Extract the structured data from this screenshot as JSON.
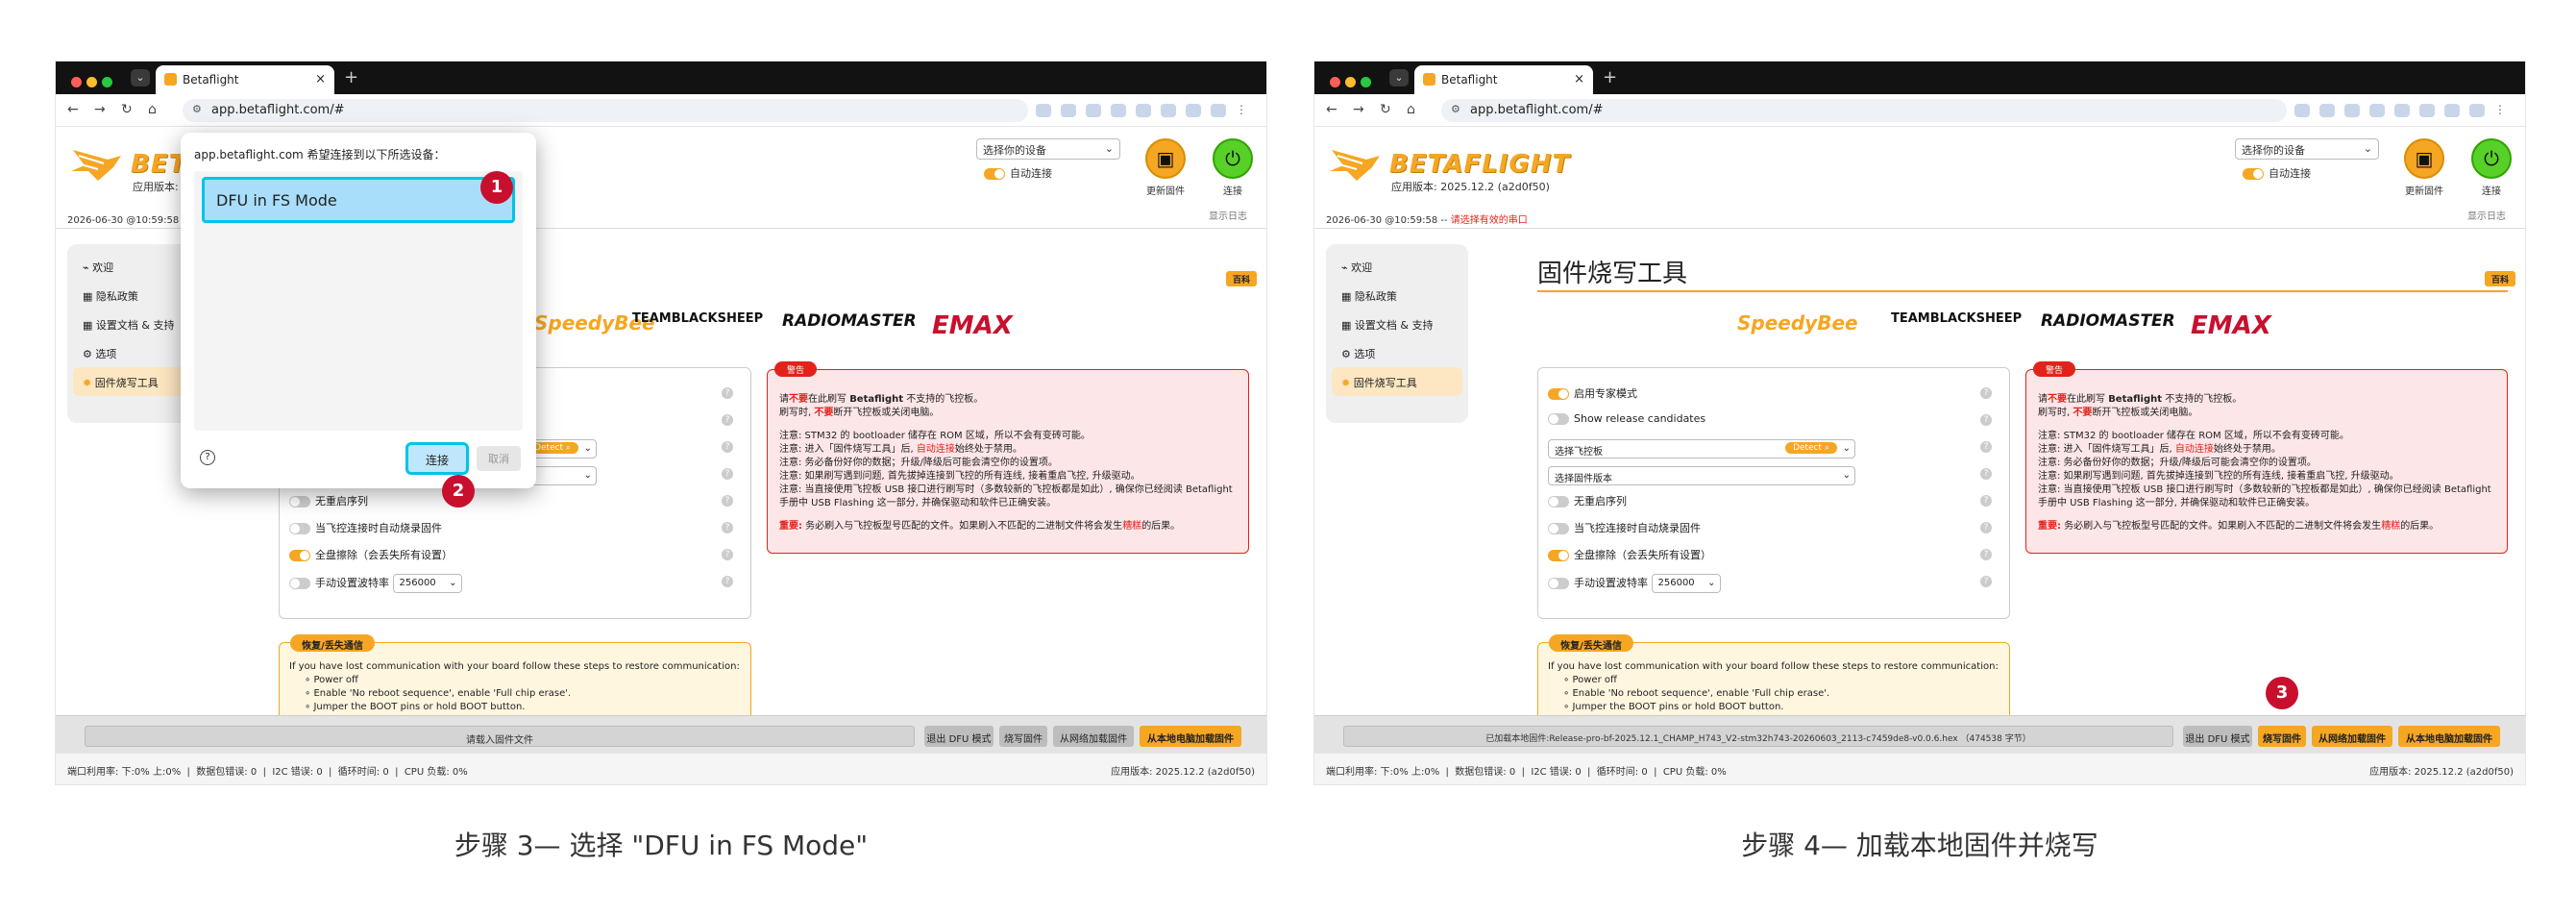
{
  "browser": {
    "tab_title": "Betaflight",
    "url": "app.betaflight.com/#"
  },
  "app": {
    "logo_text": "BETAFLIGHT",
    "version_line": "应用版本: 2025.12.2 (a2d0f50)",
    "port_select": "选择你的设备",
    "auto_connect": "自动连接",
    "update_fw_label": "更新固件",
    "connect_label": "连接",
    "date_line": "2026-06-30 @10:59:58 -- ",
    "date_warning": "请选择有效的串口",
    "show_log": "显示日志",
    "sidebar": [
      {
        "icon": "welcome-icon",
        "label": "欢迎"
      },
      {
        "icon": "privacy-icon",
        "label": "隐私政策"
      },
      {
        "icon": "docs-icon",
        "label": "设置文档 & 支持"
      },
      {
        "icon": "gear-icon",
        "label": "选项"
      },
      {
        "icon": "flash-icon",
        "label": "固件烧写工具"
      }
    ],
    "content_title": "固件烧写工具",
    "wiki_badge": "百科",
    "brands": [
      "SpeedyBee",
      "TEAMBLACKSHEEP",
      "RADIOMASTER",
      "EMAX"
    ],
    "options": {
      "expert_mode": "启用专家模式",
      "show_release": "Show release candidates",
      "board_select": "选择飞控板",
      "detect": "Detect",
      "firmware_select": "选择固件版本",
      "no_reboot": "无重启序列",
      "auto_flash": "当飞控连接时自动烧录固件",
      "full_erase": "全盘擦除（会丢失所有设置）",
      "manual_baud": "手动设置波特率",
      "baud_value": "256000"
    },
    "warning": {
      "badge": "警告",
      "l1a": "请",
      "l1b": "不要",
      "l1c": "在此刷写 ",
      "l1d": "Betaflight",
      "l1e": " 不支持的飞控板。",
      "l2a": "刷写时, ",
      "l2b": "不要",
      "l2c": "断开飞控板或关闭电脑。",
      "n1": "注意: STM32 的 bootloader 储存在 ROM 区域，所以不会有变砖可能。",
      "n2a": "注意: 进入「固件烧写工具」后, ",
      "n2b": "自动连接",
      "n2c": "始终处于禁用。",
      "n3": "注意: 务必备份好你的数据；升级/降级后可能会清空你的设置项。",
      "n4": "注意: 如果刷写遇到问题, 首先拔掉连接到飞控的所有连线, 接着重启飞控, 升级驱动。",
      "n5": "注意: 当直接使用飞控板 USB 接口进行刷写时（多数较新的飞控板都是如此）, 确保你已经阅读 Betaflight 手册中 USB Flashing 这一部分, 并确保驱动和软件已正确安装。",
      "imp_a": "重要:",
      "imp_b": " 务必刷入与飞控板型号匹配的文件。如果刷入不匹配的二进制文件将会发生",
      "imp_c": "糟糕",
      "imp_d": "的后果。"
    },
    "recovery": {
      "badge": "恢复/丢失通信",
      "intro": "If you have lost communication with your board follow these steps to restore communication:",
      "steps": [
        "Power off",
        "Enable 'No reboot sequence', enable 'Full chip erase'.",
        "Jumper the BOOT pins or hold BOOT button."
      ]
    },
    "actions": {
      "load_file_1": "请载入固件文件",
      "load_file_2": "已加载本地固件:Release-pro-bf-2025.12.1_CHAMP_H743_V2-stm32h743-20260603_2113-c7459de8-v0.0.6.hex （474538 字节）",
      "exit_dfu": "退出 DFU 模式",
      "flash": "烧写固件",
      "load_online": "从网络加载固件",
      "load_local": "从本地电脑加载固件"
    },
    "status": {
      "port_usage": "端口利用率:  下:0%  上:0%",
      "packet_errors": "数据包错误: 0",
      "i2c_errors": "I2C 错误: 0",
      "cycle_time": "循环时间: 0",
      "cpu_load": "CPU 负载: 0%",
      "app_version": "应用版本: 2025.12.2 (a2d0f50)"
    }
  },
  "dialog": {
    "title": "app.betaflight.com 希望连接到以下所选设备：",
    "device": "DFU in FS Mode",
    "connect": "连接",
    "cancel": "取消"
  },
  "markers": [
    "1",
    "2",
    "3"
  ],
  "captions": {
    "step3": "步骤 3— 选择 \"DFU in FS Mode\"",
    "step4": "步骤 4— 加载本地固件并烧写"
  },
  "colors": {
    "accent": "#f5a623",
    "warning": "#e2231a",
    "highlight": "#00c4e6",
    "marker": "#c8102e"
  }
}
